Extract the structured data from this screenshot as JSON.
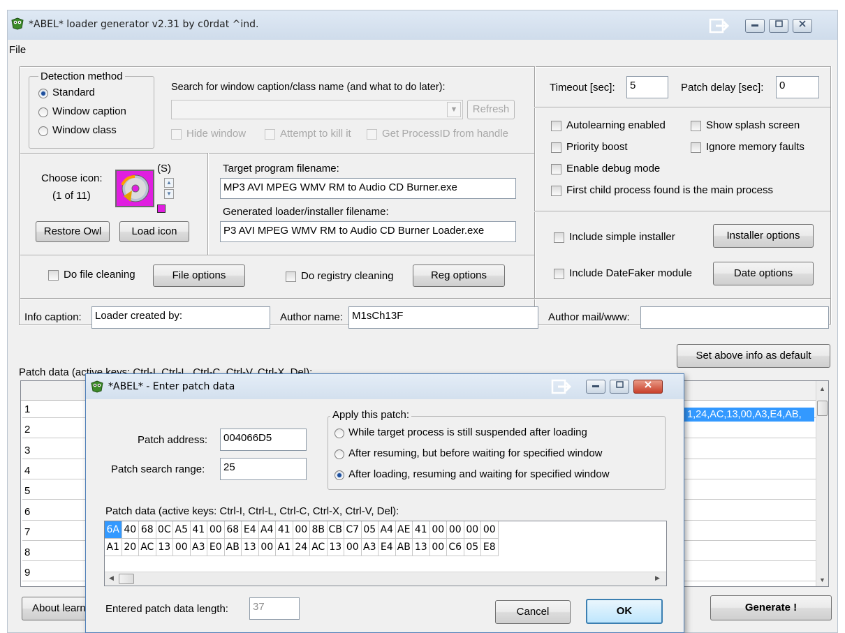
{
  "window": {
    "title": "*ABEL* loader generator v2.31 by c0rdat ^ind.",
    "controls": [
      "minimize",
      "maximize",
      "close"
    ]
  },
  "menu": {
    "file": "File"
  },
  "detection": {
    "legend": "Detection method",
    "options": [
      "Standard",
      "Window caption",
      "Window class"
    ],
    "selected": "Standard",
    "search_label": "Search for window caption/class name (and what to do later):",
    "search_value": "",
    "refresh": "Refresh",
    "hide_window": "Hide window",
    "kill": "Attempt to kill it",
    "get_pid": "Get ProcessID from handle"
  },
  "icon": {
    "choose_label": "Choose icon:",
    "counter": "(1 of 11)",
    "s_label": "(S)",
    "restore_owl": "Restore Owl",
    "load_icon": "Load icon"
  },
  "files": {
    "target_label": "Target program filename:",
    "target_value": "MP3 AVI MPEG WMV RM to Audio CD Burner.exe",
    "generated_label": "Generated loader/installer filename:",
    "generated_value": "P3 AVI MPEG WMV RM to Audio CD Burner Loader.exe"
  },
  "cleaning": {
    "file_cleaning": "Do file cleaning",
    "file_options": "File options",
    "registry_cleaning": "Do registry cleaning",
    "reg_options": "Reg options"
  },
  "timing": {
    "timeout_label": "Timeout [sec]:",
    "timeout_value": "5",
    "patch_delay_label": "Patch delay [sec]:",
    "patch_delay_value": "0"
  },
  "options": {
    "autolearning": "Autolearning enabled",
    "splash": "Show splash screen",
    "priority": "Priority boost",
    "ignore_faults": "Ignore memory faults",
    "debug": "Enable debug mode",
    "first_child": "First child process found is the main process"
  },
  "installer": {
    "include_installer": "Include simple installer",
    "installer_options": "Installer options",
    "include_datefaker": "Include DateFaker module",
    "date_options": "Date options"
  },
  "info": {
    "caption_label": "Info caption:",
    "caption_value": "Loader created by:",
    "author_label": "Author name:",
    "author_value": "M1sCh13F",
    "mail_label": "Author mail/www:",
    "mail_value": "",
    "set_default": "Set above info as default"
  },
  "patch_table": {
    "label": "Patch data (active keys: Ctrl-I, Ctrl-L, Ctrl-C, Ctrl-V, Ctrl-X, Del):",
    "rows": [
      "1",
      "2",
      "3",
      "4",
      "5",
      "6",
      "7",
      "8",
      "9"
    ],
    "row1_data": "1,24,AC,13,00,A3,E4,AB,"
  },
  "bottom": {
    "about": "About learn",
    "generate": "Generate !"
  },
  "dialog": {
    "title": "*ABEL* - Enter patch data",
    "address_label": "Patch address:",
    "address_value": "004066D5",
    "range_label": "Patch search range:",
    "range_value": "25",
    "apply_legend": "Apply this patch:",
    "apply_options": [
      "While target process is still suspended after loading",
      "After resuming, but before waiting for specified window",
      "After loading, resuming and waiting for specified window"
    ],
    "apply_selected_index": 2,
    "data_label": "Patch data (active keys: Ctrl-I, Ctrl-L, Ctrl-C, Ctrl-X, Ctrl-V, Del):",
    "hex_rows": [
      [
        "6A",
        "40",
        "68",
        "0C",
        "A5",
        "41",
        "00",
        "68",
        "E4",
        "A4",
        "41",
        "00",
        "8B",
        "CB",
        "C7",
        "05",
        "A4",
        "AE",
        "41",
        "00",
        "00",
        "00",
        "00"
      ],
      [
        "A1",
        "20",
        "AC",
        "13",
        "00",
        "A3",
        "E0",
        "AB",
        "13",
        "00",
        "A1",
        "24",
        "AC",
        "13",
        "00",
        "A3",
        "E4",
        "AB",
        "13",
        "00",
        "C6",
        "05",
        "E8"
      ]
    ],
    "length_label": "Entered patch data length:",
    "length_value": "37",
    "cancel": "Cancel",
    "ok": "OK"
  },
  "colors": {
    "selection": "#3399ff",
    "icon_magenta": "#e01ee0",
    "titlebar": "#d6e2ef",
    "close_red": "#d9452e"
  }
}
